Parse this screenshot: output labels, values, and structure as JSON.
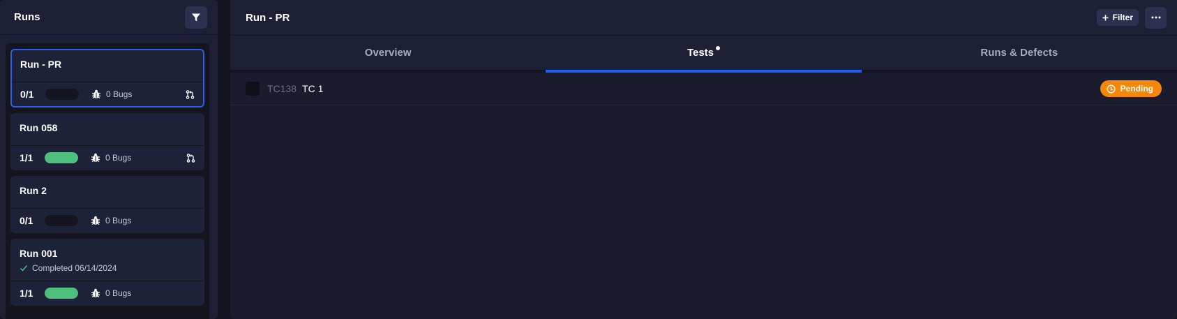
{
  "left_panel": {
    "title": "Runs",
    "runs": [
      {
        "name": "Run - PR",
        "count": "0/1",
        "progress": 0,
        "bugs": "0 Bugs",
        "selected": true,
        "pr": true,
        "subtitle": ""
      },
      {
        "name": "Run 058",
        "count": "1/1",
        "progress": 1,
        "bugs": "0 Bugs",
        "selected": false,
        "pr": true,
        "subtitle": ""
      },
      {
        "name": "Run 2",
        "count": "0/1",
        "progress": 0,
        "bugs": "0 Bugs",
        "selected": false,
        "pr": false,
        "subtitle": ""
      },
      {
        "name": "Run 001",
        "count": "1/1",
        "progress": 1,
        "bugs": "0 Bugs",
        "selected": false,
        "pr": false,
        "subtitle": "Completed 06/14/2024"
      }
    ]
  },
  "right_panel": {
    "title": "Run - PR",
    "filter_label": "Filter",
    "tabs": [
      {
        "label": "Overview",
        "active": false
      },
      {
        "label": "Tests",
        "active": true
      },
      {
        "label": "Runs & Defects",
        "active": false
      }
    ],
    "tests": [
      {
        "id": "TC138",
        "name": "TC 1",
        "status": "Pending"
      }
    ]
  },
  "colors": {
    "accent": "#1f5ff5",
    "success": "#4fbf7e",
    "pending": "#f5880a"
  },
  "icons": {
    "filter": "funnel-icon",
    "bug": "bug-icon",
    "pr": "pull-request-icon",
    "check": "check-icon",
    "clock": "clock-icon",
    "plus": "plus-icon",
    "more": "ellipsis-icon"
  }
}
